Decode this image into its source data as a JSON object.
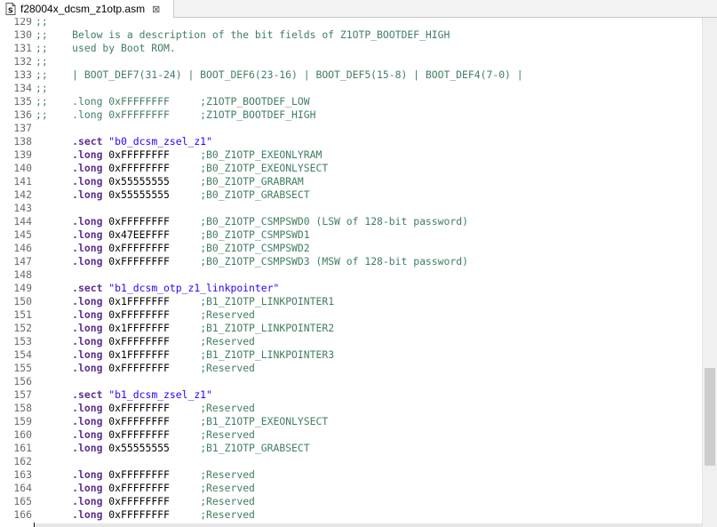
{
  "tab": {
    "title": "f28004x_dcsm_z1otp.asm",
    "close_glyph": "⊠",
    "icon": "asm-file-icon"
  },
  "editor": {
    "lines": [
      {
        "n": "129",
        "parts": [
          {
            "t": ";;",
            "c": "comment"
          }
        ]
      },
      {
        "n": "130",
        "parts": [
          {
            "t": ";;    Below is a description of the bit fields of Z1OTP_BOOTDEF_HIGH",
            "c": "comment"
          }
        ]
      },
      {
        "n": "131",
        "parts": [
          {
            "t": ";;    used by Boot ROM.",
            "c": "comment"
          }
        ]
      },
      {
        "n": "132",
        "parts": [
          {
            "t": ";;",
            "c": "comment"
          }
        ]
      },
      {
        "n": "133",
        "parts": [
          {
            "t": ";;    | BOOT_DEF7(31-24) | BOOT_DEF6(23-16) | BOOT_DEF5(15-8) | BOOT_DEF4(7-0) |",
            "c": "comment"
          }
        ]
      },
      {
        "n": "134",
        "parts": [
          {
            "t": ";;",
            "c": "comment"
          }
        ]
      },
      {
        "n": "135",
        "parts": [
          {
            "t": ";;    .long 0xFFFFFFFF     ;Z1OTP_BOOTDEF_LOW",
            "c": "comment"
          }
        ]
      },
      {
        "n": "136",
        "parts": [
          {
            "t": ";;    .long 0xFFFFFFFF     ;Z1OTP_BOOTDEF_HIGH",
            "c": "comment"
          }
        ]
      },
      {
        "n": "137",
        "parts": []
      },
      {
        "n": "138",
        "parts": [
          {
            "t": "      ",
            "c": "num"
          },
          {
            "t": ".sect",
            "c": "dir"
          },
          {
            "t": " \"b0_dcsm_zsel_z1\"",
            "c": "str"
          }
        ]
      },
      {
        "n": "139",
        "parts": [
          {
            "t": "      ",
            "c": "num"
          },
          {
            "t": ".long",
            "c": "dir"
          },
          {
            "t": " 0xFFFFFFFF     ",
            "c": "num"
          },
          {
            "t": ";B0_Z1OTP_EXEONLYRAM",
            "c": "comment"
          }
        ]
      },
      {
        "n": "140",
        "parts": [
          {
            "t": "      ",
            "c": "num"
          },
          {
            "t": ".long",
            "c": "dir"
          },
          {
            "t": " 0xFFFFFFFF     ",
            "c": "num"
          },
          {
            "t": ";B0_Z1OTP_EXEONLYSECT",
            "c": "comment"
          }
        ]
      },
      {
        "n": "141",
        "parts": [
          {
            "t": "      ",
            "c": "num"
          },
          {
            "t": ".long",
            "c": "dir"
          },
          {
            "t": " 0x55555555     ",
            "c": "num"
          },
          {
            "t": ";B0_Z1OTP_GRABRAM",
            "c": "comment"
          }
        ]
      },
      {
        "n": "142",
        "parts": [
          {
            "t": "      ",
            "c": "num"
          },
          {
            "t": ".long",
            "c": "dir"
          },
          {
            "t": " 0x55555555     ",
            "c": "num"
          },
          {
            "t": ";B0_Z1OTP_GRABSECT",
            "c": "comment"
          }
        ]
      },
      {
        "n": "143",
        "parts": []
      },
      {
        "n": "144",
        "parts": [
          {
            "t": "      ",
            "c": "num"
          },
          {
            "t": ".long",
            "c": "dir"
          },
          {
            "t": " 0xFFFFFFFF     ",
            "c": "num"
          },
          {
            "t": ";B0_Z1OTP_CSMPSWD0 (LSW of 128-bit password)",
            "c": "comment"
          }
        ]
      },
      {
        "n": "145",
        "parts": [
          {
            "t": "      ",
            "c": "num"
          },
          {
            "t": ".long",
            "c": "dir"
          },
          {
            "t": " 0x47EEFFFF     ",
            "c": "num"
          },
          {
            "t": ";B0_Z1OTP_CSMPSWD1",
            "c": "comment"
          }
        ]
      },
      {
        "n": "146",
        "parts": [
          {
            "t": "      ",
            "c": "num"
          },
          {
            "t": ".long",
            "c": "dir"
          },
          {
            "t": " 0xFFFFFFFF     ",
            "c": "num"
          },
          {
            "t": ";B0_Z1OTP_CSMPSWD2",
            "c": "comment"
          }
        ]
      },
      {
        "n": "147",
        "parts": [
          {
            "t": "      ",
            "c": "num"
          },
          {
            "t": ".long",
            "c": "dir"
          },
          {
            "t": " 0xFFFFFFFF     ",
            "c": "num"
          },
          {
            "t": ";B0_Z1OTP_CSMPSWD3 (MSW of 128-bit password)",
            "c": "comment"
          }
        ]
      },
      {
        "n": "148",
        "parts": []
      },
      {
        "n": "149",
        "parts": [
          {
            "t": "      ",
            "c": "num"
          },
          {
            "t": ".sect",
            "c": "dir"
          },
          {
            "t": " \"b1_dcsm_otp_z1_linkpointer\"",
            "c": "str"
          }
        ]
      },
      {
        "n": "150",
        "parts": [
          {
            "t": "      ",
            "c": "num"
          },
          {
            "t": ".long",
            "c": "dir"
          },
          {
            "t": " 0x1FFFFFFF     ",
            "c": "num"
          },
          {
            "t": ";B1_Z1OTP_LINKPOINTER1",
            "c": "comment"
          }
        ]
      },
      {
        "n": "151",
        "parts": [
          {
            "t": "      ",
            "c": "num"
          },
          {
            "t": ".long",
            "c": "dir"
          },
          {
            "t": " 0xFFFFFFFF     ",
            "c": "num"
          },
          {
            "t": ";Reserved",
            "c": "comment"
          }
        ]
      },
      {
        "n": "152",
        "parts": [
          {
            "t": "      ",
            "c": "num"
          },
          {
            "t": ".long",
            "c": "dir"
          },
          {
            "t": " 0x1FFFFFFF     ",
            "c": "num"
          },
          {
            "t": ";B1_Z1OTP_LINKPOINTER2",
            "c": "comment"
          }
        ]
      },
      {
        "n": "153",
        "parts": [
          {
            "t": "      ",
            "c": "num"
          },
          {
            "t": ".long",
            "c": "dir"
          },
          {
            "t": " 0xFFFFFFFF     ",
            "c": "num"
          },
          {
            "t": ";Reserved",
            "c": "comment"
          }
        ]
      },
      {
        "n": "154",
        "parts": [
          {
            "t": "      ",
            "c": "num"
          },
          {
            "t": ".long",
            "c": "dir"
          },
          {
            "t": " 0x1FFFFFFF     ",
            "c": "num"
          },
          {
            "t": ";B1_Z1OTP_LINKPOINTER3",
            "c": "comment"
          }
        ]
      },
      {
        "n": "155",
        "parts": [
          {
            "t": "      ",
            "c": "num"
          },
          {
            "t": ".long",
            "c": "dir"
          },
          {
            "t": " 0xFFFFFFFF     ",
            "c": "num"
          },
          {
            "t": ";Reserved",
            "c": "comment"
          }
        ]
      },
      {
        "n": "156",
        "parts": []
      },
      {
        "n": "157",
        "parts": [
          {
            "t": "      ",
            "c": "num"
          },
          {
            "t": ".sect",
            "c": "dir"
          },
          {
            "t": " \"b1_dcsm_zsel_z1\"",
            "c": "str"
          }
        ]
      },
      {
        "n": "158",
        "parts": [
          {
            "t": "      ",
            "c": "num"
          },
          {
            "t": ".long",
            "c": "dir"
          },
          {
            "t": " 0xFFFFFFFF     ",
            "c": "num"
          },
          {
            "t": ";Reserved",
            "c": "comment"
          }
        ]
      },
      {
        "n": "159",
        "parts": [
          {
            "t": "      ",
            "c": "num"
          },
          {
            "t": ".long",
            "c": "dir"
          },
          {
            "t": " 0xFFFFFFFF     ",
            "c": "num"
          },
          {
            "t": ";B1_Z1OTP_EXEONLYSECT",
            "c": "comment"
          }
        ]
      },
      {
        "n": "160",
        "parts": [
          {
            "t": "      ",
            "c": "num"
          },
          {
            "t": ".long",
            "c": "dir"
          },
          {
            "t": " 0xFFFFFFFF     ",
            "c": "num"
          },
          {
            "t": ";Reserved",
            "c": "comment"
          }
        ]
      },
      {
        "n": "161",
        "parts": [
          {
            "t": "      ",
            "c": "num"
          },
          {
            "t": ".long",
            "c": "dir"
          },
          {
            "t": " 0x55555555     ",
            "c": "num"
          },
          {
            "t": ";B1_Z1OTP_GRABSECT",
            "c": "comment"
          }
        ]
      },
      {
        "n": "162",
        "parts": []
      },
      {
        "n": "163",
        "parts": [
          {
            "t": "      ",
            "c": "num"
          },
          {
            "t": ".long",
            "c": "dir"
          },
          {
            "t": " 0xFFFFFFFF     ",
            "c": "num"
          },
          {
            "t": ";Reserved",
            "c": "comment"
          }
        ]
      },
      {
        "n": "164",
        "parts": [
          {
            "t": "      ",
            "c": "num"
          },
          {
            "t": ".long",
            "c": "dir"
          },
          {
            "t": " 0xFFFFFFFF     ",
            "c": "num"
          },
          {
            "t": ";Reserved",
            "c": "comment"
          }
        ]
      },
      {
        "n": "165",
        "parts": [
          {
            "t": "      ",
            "c": "num"
          },
          {
            "t": ".long",
            "c": "dir"
          },
          {
            "t": " 0xFFFFFFFF     ",
            "c": "num"
          },
          {
            "t": ";Reserved",
            "c": "comment"
          }
        ]
      },
      {
        "n": "166",
        "parts": [
          {
            "t": "      ",
            "c": "num"
          },
          {
            "t": ".long",
            "c": "dir"
          },
          {
            "t": " 0xFFFFFFFF     ",
            "c": "num"
          },
          {
            "t": ";Reserved",
            "c": "comment"
          }
        ]
      }
    ]
  },
  "colors": {
    "comment": "#3f7f5f",
    "directive": "#5c2d91",
    "string": "#2a00ff",
    "line_number": "#6b6b6b"
  }
}
